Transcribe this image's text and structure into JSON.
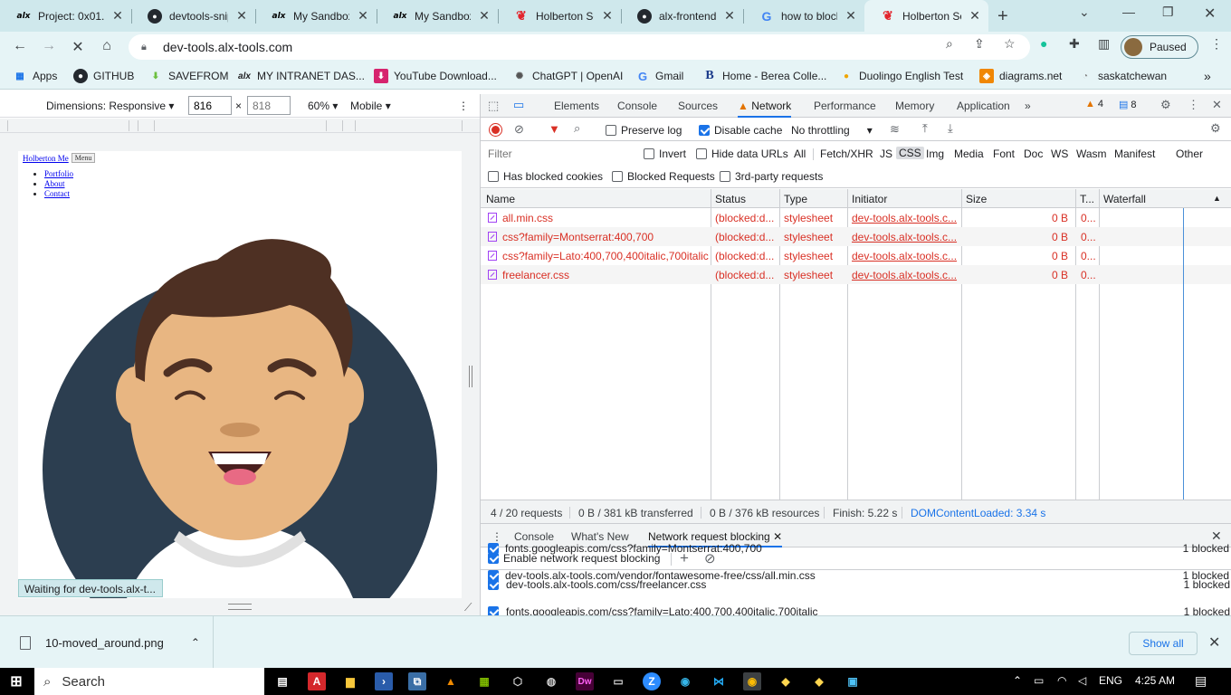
{
  "browser": {
    "tabs": [
      {
        "title": "Project: 0x01.",
        "icon": "alx-icon"
      },
      {
        "title": "devtools-snip",
        "icon": "github-icon"
      },
      {
        "title": "My Sandboxe",
        "icon": "alx-icon"
      },
      {
        "title": "My Sandboxe",
        "icon": "alx-icon"
      },
      {
        "title": "Holberton Sc",
        "icon": "holberton-icon"
      },
      {
        "title": "alx-frontend",
        "icon": "github-icon"
      },
      {
        "title": "how to block",
        "icon": "google-icon"
      },
      {
        "title": "Holberton Sc",
        "icon": "holberton-icon",
        "active": true
      }
    ],
    "url": "dev-tools.alx-tools.com",
    "profile_label": "Paused",
    "bookmarks": [
      {
        "label": "Apps",
        "icon": "apps-grid-icon"
      },
      {
        "label": "GITHUB",
        "icon": "github-icon"
      },
      {
        "label": "SAVEFROM",
        "icon": "savefrom-icon"
      },
      {
        "label": "MY INTRANET DAS...",
        "icon": "alx-icon"
      },
      {
        "label": "YouTube Download...",
        "icon": "youtube-downloader-icon"
      },
      {
        "label": "ChatGPT | OpenAI",
        "icon": "openai-icon"
      },
      {
        "label": "Gmail",
        "icon": "google-icon"
      },
      {
        "label": "Home - Berea Colle...",
        "icon": "berea-icon"
      },
      {
        "label": "Duolingo English Test",
        "icon": "duolingo-icon"
      },
      {
        "label": "diagrams.net",
        "icon": "drawio-icon"
      },
      {
        "label": "saskatchewan",
        "icon": "globe-icon"
      }
    ]
  },
  "device_toolbar": {
    "dimensions_label": "Dimensions: Responsive",
    "width": "816",
    "height_placeholder": "818",
    "times": "×",
    "zoom": "60%",
    "mode": "Mobile"
  },
  "page": {
    "brand_link": "Holberton Me",
    "menu_button": "Menu",
    "nav_links": [
      "Portfolio",
      "About",
      "Contact"
    ],
    "status_text": "Waiting for dev-tools.alx-t..."
  },
  "devtools": {
    "tabs": [
      "Elements",
      "Console",
      "Sources",
      "Network",
      "Performance",
      "Memory",
      "Application"
    ],
    "active_tab": "Network",
    "warnings_count": "4",
    "messages_count": "8",
    "network_toolbar": {
      "preserve_log": "Preserve log",
      "disable_cache": "Disable cache",
      "throttling": "No throttling"
    },
    "filter": {
      "placeholder": "Filter",
      "invert": "Invert",
      "hide_data_urls": "Hide data URLs",
      "types": [
        "All",
        "Fetch/XHR",
        "JS",
        "CSS",
        "Img",
        "Media",
        "Font",
        "Doc",
        "WS",
        "Wasm",
        "Manifest",
        "Other"
      ],
      "active_type": "CSS",
      "has_blocked_cookies": "Has blocked cookies",
      "blocked_requests": "Blocked Requests",
      "third_party": "3rd-party requests"
    },
    "columns": [
      "Name",
      "Status",
      "Type",
      "Initiator",
      "Size",
      "T...",
      "Waterfall"
    ],
    "requests": [
      {
        "name": "all.min.css",
        "status": "(blocked:d...",
        "type": "stylesheet",
        "initiator": "dev-tools.alx-tools.c...",
        "size": "0 B",
        "time": "0..."
      },
      {
        "name": "css?family=Montserrat:400,700",
        "status": "(blocked:d...",
        "type": "stylesheet",
        "initiator": "dev-tools.alx-tools.c...",
        "size": "0 B",
        "time": "0..."
      },
      {
        "name": "css?family=Lato:400,700,400italic,700italic",
        "status": "(blocked:d...",
        "type": "stylesheet",
        "initiator": "dev-tools.alx-tools.c...",
        "size": "0 B",
        "time": "0..."
      },
      {
        "name": "freelancer.css",
        "status": "(blocked:d...",
        "type": "stylesheet",
        "initiator": "dev-tools.alx-tools.c...",
        "size": "0 B",
        "time": "0..."
      }
    ],
    "summary": {
      "requests": "4 / 20 requests",
      "transferred": "0 B / 381 kB transferred",
      "resources": "0 B / 376 kB resources",
      "finish": "Finish: 5.22 s",
      "dom_content_loaded": "DOMContentLoaded: 3.34 s"
    },
    "drawer": {
      "tabs": [
        "Console",
        "What's New",
        "Network request blocking"
      ],
      "active_tab": "Network request blocking",
      "enable_label": "Enable network request blocking",
      "patterns": [
        {
          "pattern": "dev-tools.alx-tools.com/css/freelancer.css",
          "count": "1 blocked"
        },
        {
          "pattern": "fonts.googleapis.com/css?family=Lato:400,700,400italic,700italic",
          "count": "1 blocked"
        },
        {
          "pattern": "fonts.googleapis.com/css?family=Montserrat:400,700",
          "count": "1 blocked"
        },
        {
          "pattern": "dev-tools.alx-tools.com/vendor/fontawesome-free/css/all.min.css",
          "count": "1 blocked"
        }
      ]
    }
  },
  "downloads": {
    "file": "10-moved_around.png",
    "show_all": "Show all"
  },
  "taskbar": {
    "search": "Search",
    "language": "ENG",
    "time": "4:25 AM"
  }
}
